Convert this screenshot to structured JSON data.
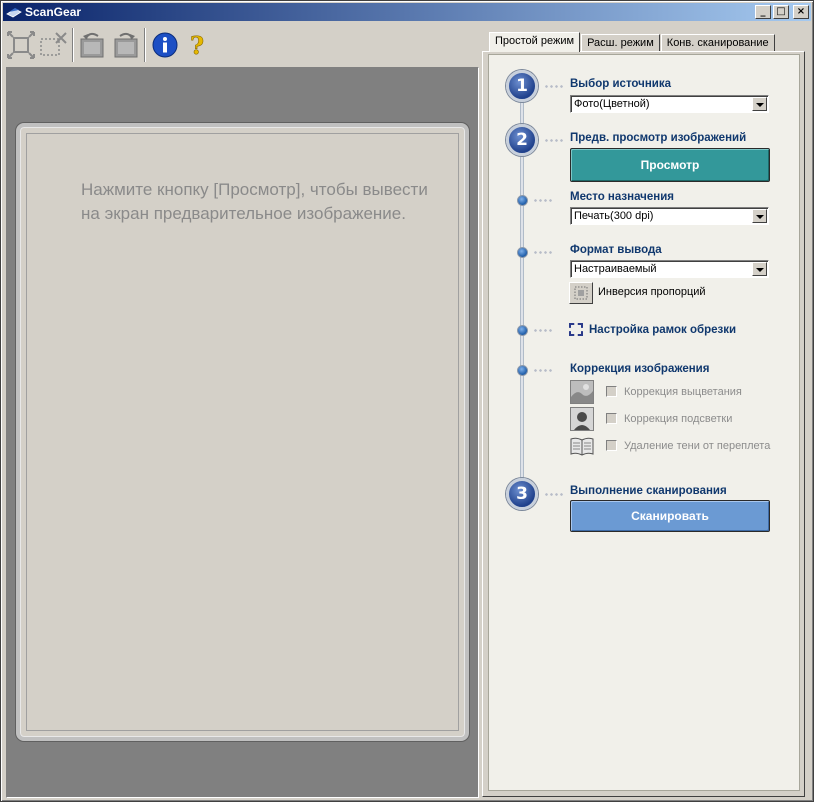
{
  "window": {
    "title": "ScanGear"
  },
  "titlebar_buttons": {
    "minimize": "_",
    "maximize": "□",
    "close": "×"
  },
  "toolbar": {
    "items": [
      {
        "name": "auto-crop-icon"
      },
      {
        "name": "clear-crop-icon"
      },
      {
        "name": "rotate-left-icon"
      },
      {
        "name": "rotate-right-icon"
      },
      {
        "name": "info-icon"
      },
      {
        "name": "help-icon"
      }
    ]
  },
  "preview": {
    "message": "Нажмите кнопку [Просмотр], чтобы вывести на экран предварительное изображение."
  },
  "tabs": [
    {
      "label": "Простой режим",
      "active": true
    },
    {
      "label": "Расш. режим",
      "active": false
    },
    {
      "label": "Конв. сканирование",
      "active": false
    }
  ],
  "panel": {
    "step1": {
      "number": "1",
      "label": "Выбор источника",
      "value": "Фото(Цветной)"
    },
    "step2": {
      "number": "2",
      "label": "Предв. просмотр изображений",
      "button": "Просмотр"
    },
    "destination": {
      "label": "Место назначения",
      "value": "Печать(300 dpi)"
    },
    "output_format": {
      "label": "Формат вывода",
      "value": "Настраиваемый",
      "invert_label": "Инверсия пропорций"
    },
    "crop": {
      "label": "Настройка рамок обрезки"
    },
    "correction": {
      "label": "Коррекция изображения",
      "options": [
        {
          "label": "Коррекция выцветания",
          "checked": false
        },
        {
          "label": "Коррекция подсветки",
          "checked": false
        },
        {
          "label": "Удаление тени от переплета",
          "checked": false
        }
      ]
    },
    "step3": {
      "number": "3",
      "label": "Выполнение сканирования",
      "button": "Сканировать"
    }
  },
  "colors": {
    "title_gradient_start": "#0a246a",
    "preview_button": "#33989a",
    "scan_button": "#6b9ad3",
    "label_text": "#10386e"
  }
}
